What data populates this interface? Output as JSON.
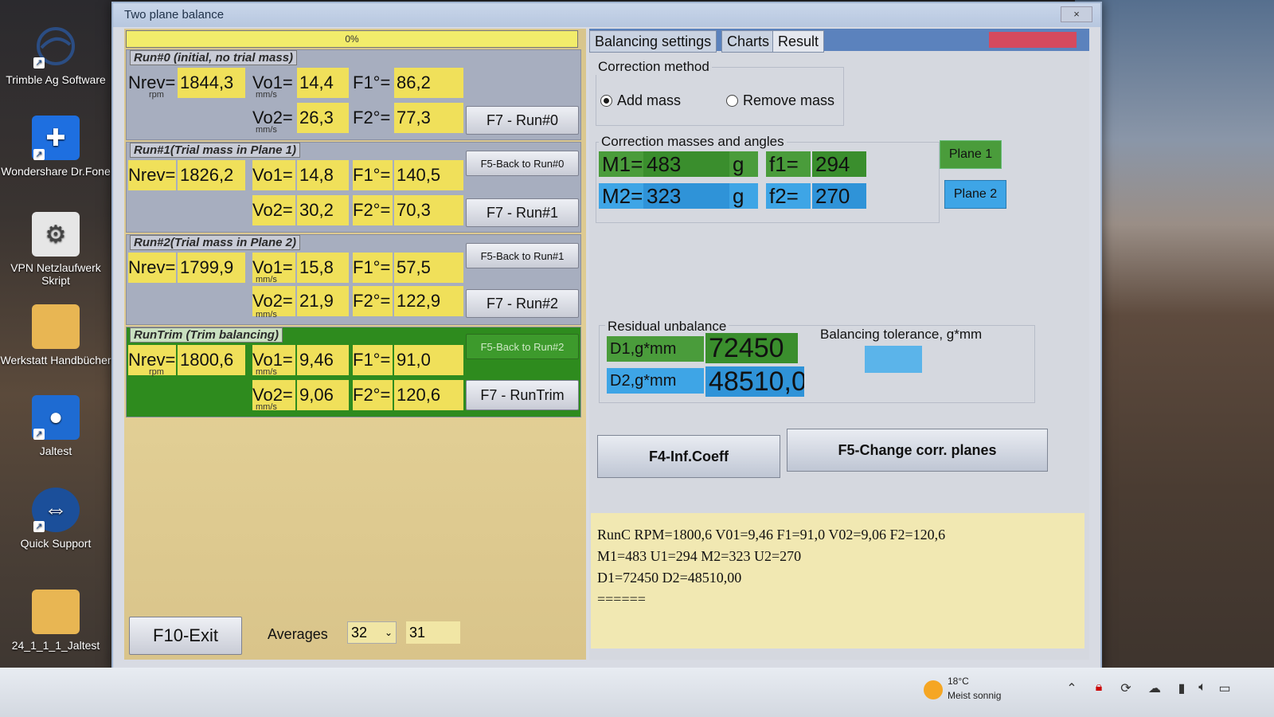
{
  "desktop": {
    "icons": [
      {
        "label": "Trimble Ag Software",
        "icon": "trimble-logo"
      },
      {
        "label": "Wondershare Dr.Fone",
        "icon": "drfone-plus"
      },
      {
        "label": "VPN Netzlaufwerk Skript",
        "icon": "gears"
      },
      {
        "label": "Werkstatt Handbücher",
        "icon": "folder"
      },
      {
        "label": "Jaltest",
        "icon": "jaltest-logo"
      },
      {
        "label": "Quick Support",
        "icon": "quick-support-arrows"
      },
      {
        "label": "24_1_1_1_Jaltest",
        "icon": "folder"
      }
    ]
  },
  "window": {
    "title": "Two plane balance",
    "close": "×"
  },
  "left": {
    "progress": "0%",
    "runs": [
      {
        "header": "Run#0 (initial, no trial mass)",
        "nrev": "1844,3",
        "vo1": "14,4",
        "f1": "86,2",
        "vo2": "26,3",
        "f2": "77,3",
        "back": "",
        "run": "F7 - Run#0"
      },
      {
        "header": "Run#1(Trial mass in Plane 1)",
        "nrev": "1826,2",
        "vo1": "14,8",
        "f1": "140,5",
        "vo2": "30,2",
        "f2": "70,3",
        "back": "F5-Back to Run#0",
        "run": "F7 - Run#1"
      },
      {
        "header": "Run#2(Trial mass in Plane 2)",
        "nrev": "1799,9",
        "vo1": "15,8",
        "f1": "57,5",
        "vo2": "21,9",
        "f2": "122,9",
        "back": "F5-Back to Run#1",
        "run": "F7 - Run#2"
      },
      {
        "header": "RunTrim (Trim balancing)",
        "nrev": "1800,6",
        "vo1": "9,46",
        "f1": "91,0",
        "vo2": "9,06",
        "f2": "120,6",
        "back": "F5-Back to Run#2",
        "run": "F7 - RunTrim"
      }
    ],
    "labels": {
      "nrev": "Nrev=",
      "rpm": "rpm",
      "vo1": "Vo1=",
      "vo2": "Vo2=",
      "mms": "mm/s",
      "f1": "F1°=",
      "f2": "F2°="
    },
    "exit": "F10-Exit",
    "averages_label": "Averages",
    "averages_value": "32",
    "averages_count": "31"
  },
  "right": {
    "tabs": [
      "Balancing settings",
      "Charts",
      "Result"
    ],
    "active_tab": "Result",
    "correction_method": {
      "title": "Correction method",
      "add": "Add mass",
      "remove": "Remove mass",
      "selected": "add"
    },
    "correction_masses": {
      "title": "Correction masses and angles",
      "m1_label": "M1=",
      "m1": "483",
      "unit": "g",
      "f1_label": "f1=",
      "f1": "294",
      "m2_label": "M2=",
      "m2": "323",
      "f2_label": "f2=",
      "f2": "270",
      "plane1": "Plane 1",
      "plane2": "Plane 2"
    },
    "residual": {
      "title": "Residual unbalance",
      "d1_label": "D1,g*mm",
      "d1": "72450",
      "d2_label": "D2,g*mm",
      "d2": "48510,0",
      "tolerance_label": "Balancing tolerance, g*mm"
    },
    "buttons": {
      "inf_coeff": "F4-Inf.Coeff",
      "change_planes": "F5-Change corr. planes"
    },
    "log": [
      "RunC  RPM=1800,6 V01=9,46 F1=91,0 V02=9,06 F2=120,6",
      "M1=483 U1=294 M2=323 U2=270",
      "D1=72450 D2=48510,00",
      "======"
    ]
  },
  "taskbar": {
    "weather_temp": "18°C",
    "weather_desc": "Meist sonnig"
  },
  "colors": {
    "yellow": "#f0e05a",
    "green": "#2e8b1e",
    "blue": "#3ea5e6",
    "panel": "#d5d8df"
  }
}
